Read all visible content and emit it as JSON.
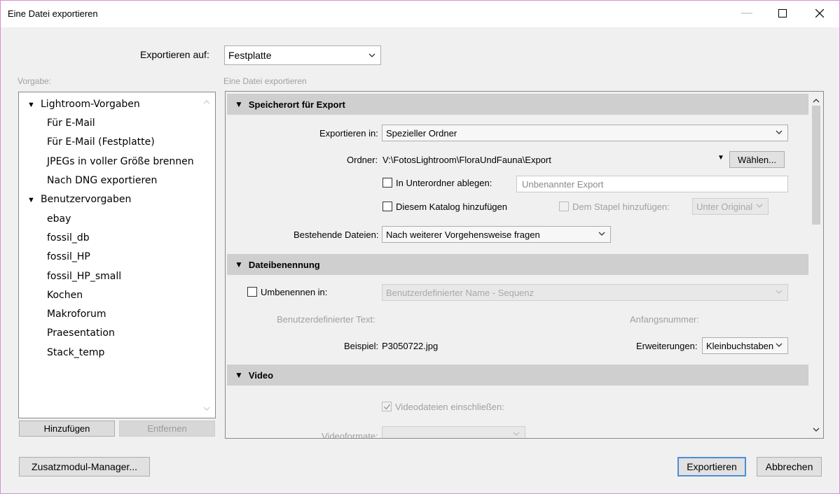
{
  "window": {
    "title": "Eine Datei exportieren",
    "minimize_glyph": "—",
    "maximize_glyph": "☐",
    "close_glyph": "✕"
  },
  "export_to": {
    "label": "Exportieren auf:",
    "value": "Festplatte"
  },
  "preset_label": "Vorgabe:",
  "panel_label": "Eine Datei exportieren",
  "presets": {
    "groups": [
      {
        "name": "Lightroom-Vorgaben",
        "items": [
          "Für E-Mail",
          "Für E-Mail (Festplatte)",
          "JPEGs in voller Größe brennen",
          "Nach DNG exportieren"
        ]
      },
      {
        "name": "Benutzervorgaben",
        "items": [
          "ebay",
          "fossil_db",
          "fossil_HP",
          "fossil_HP_small",
          "Kochen",
          "Makroforum",
          "Praesentation",
          "Stack_temp"
        ]
      }
    ],
    "add_button": "Hinzufügen",
    "remove_button": "Entfernen"
  },
  "sections": {
    "location": {
      "title": "Speicherort für Export",
      "export_in_label": "Exportieren in:",
      "export_in_value": "Spezieller Ordner",
      "folder_label": "Ordner:",
      "folder_path": "V:\\FotosLightroom\\FloraUndFauna\\Export",
      "choose_button": "Wählen...",
      "subfolder_label": "In Unterordner ablegen:",
      "subfolder_placeholder": "Unbenannter Export",
      "add_catalog_label": "Diesem Katalog hinzufügen",
      "add_stack_label": "Dem Stapel hinzufügen:",
      "stack_value": "Unter Original",
      "existing_files_label": "Bestehende Dateien:",
      "existing_files_value": "Nach weiterer Vorgehensweise fragen"
    },
    "naming": {
      "title": "Dateibenennung",
      "rename_label": "Umbenennen in:",
      "rename_value": "Benutzerdefinierter Name - Sequenz",
      "custom_text_label": "Benutzerdefinierter Text:",
      "start_number_label": "Anfangsnummer:",
      "example_label": "Beispiel:",
      "example_value": "P3050722.jpg",
      "extensions_label": "Erweiterungen:",
      "extensions_value": "Kleinbuchstaben"
    },
    "video": {
      "title": "Video",
      "include_label": "Videodateien einschließen:",
      "formats_label": "Videoformate:"
    }
  },
  "footer": {
    "plugin_manager": "Zusatzmodul-Manager...",
    "export": "Exportieren",
    "cancel": "Abbrechen"
  },
  "colors": {
    "primary_border": "#4a8fd6",
    "section_header": "#cfcfcf",
    "window_border": "#d58fd3"
  }
}
